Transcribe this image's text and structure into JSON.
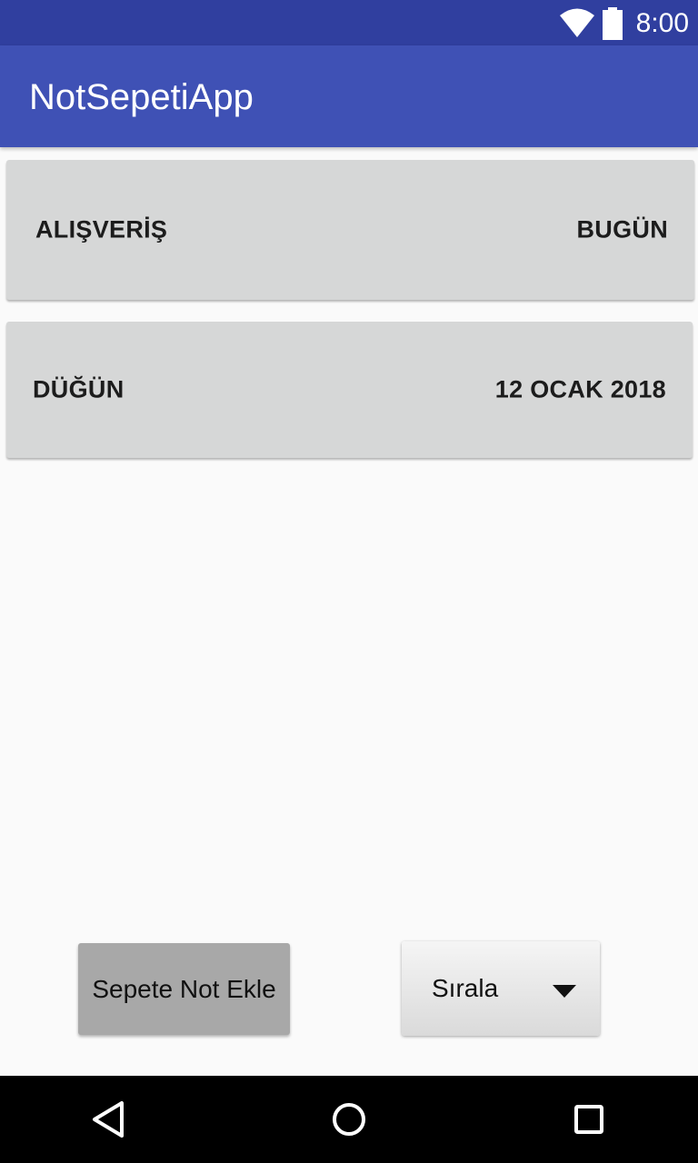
{
  "status_bar": {
    "time": "8:00",
    "icons": [
      "wifi-icon",
      "battery-icon"
    ]
  },
  "app_bar": {
    "title": "NotSepetiApp"
  },
  "notes": [
    {
      "title": "ALIŞVERİŞ",
      "date": "BUGÜN"
    },
    {
      "title": "DÜĞÜN",
      "date": "12 OCAK 2018"
    }
  ],
  "bottom_controls": {
    "add_button_label": "Sepete Not Ekle",
    "sort_spinner_value": "Sırala"
  },
  "nav_bar": {
    "icons": [
      "back-icon",
      "home-icon",
      "recents-icon"
    ]
  },
  "colors": {
    "status_bar": "#303f9f",
    "app_bar": "#3f51b5",
    "card": "#d6d7d7",
    "background": "#fafafa",
    "add_button": "#a8a8a8"
  }
}
